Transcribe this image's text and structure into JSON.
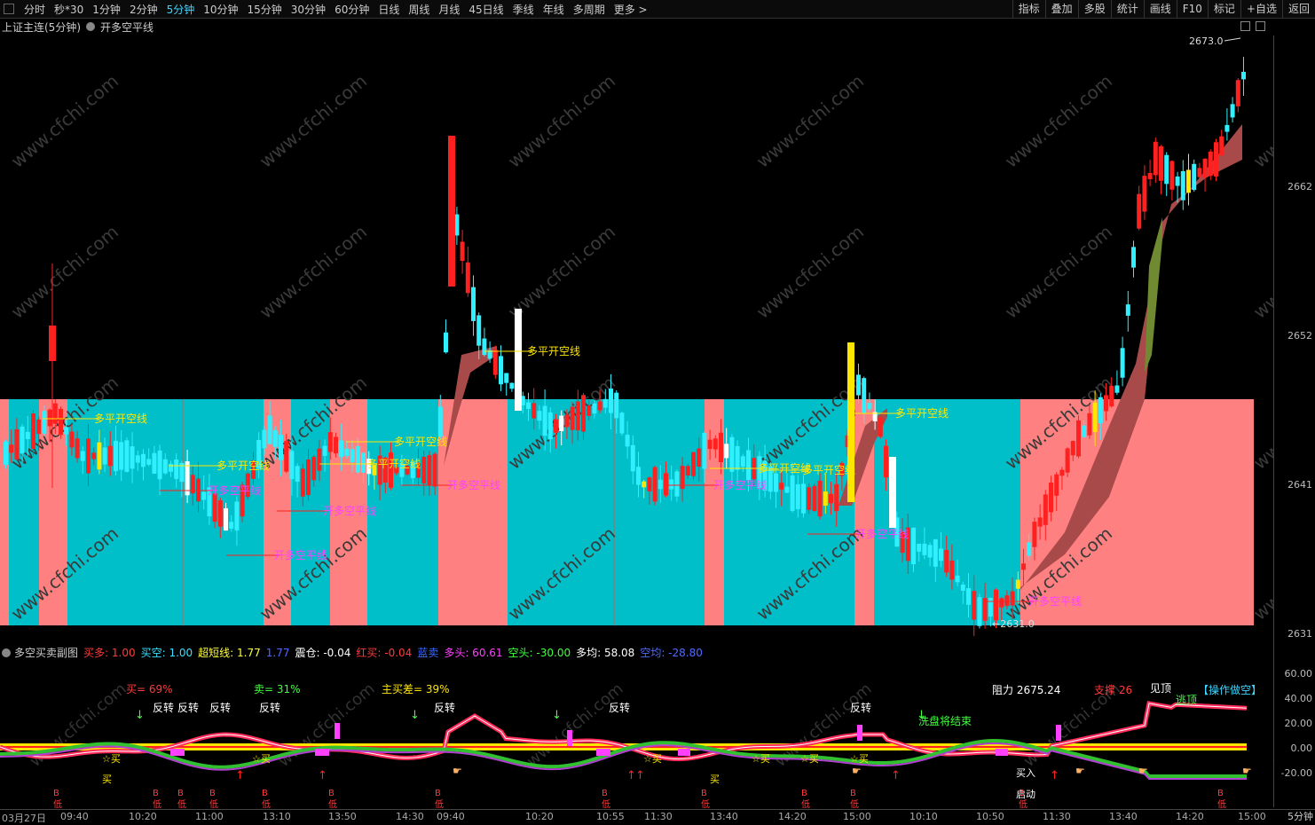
{
  "toolbar": {
    "items": [
      "分时",
      "秒*30",
      "1分钟",
      "2分钟",
      "5分钟",
      "10分钟",
      "15分钟",
      "30分钟",
      "60分钟",
      "日线",
      "周线",
      "月线",
      "45日线",
      "季线",
      "年线",
      "多周期",
      "更多 >"
    ],
    "active": "5分钟",
    "right_items": [
      "指标",
      "叠加",
      "多股",
      "统计",
      "画线",
      "F10",
      "标记",
      "+自选",
      "返回"
    ]
  },
  "chart": {
    "title": "上证主连(5分钟)",
    "indicator": "开多空平线",
    "high_label": "2673.0",
    "low_label": "2631.0",
    "price_axis": [
      "2662",
      "2652",
      "2641",
      "2631"
    ],
    "annotations": {
      "up_line": "多平开空线",
      "down_line": "开多空平线"
    }
  },
  "sub": {
    "name": "多空买卖副图",
    "fields": [
      {
        "label": "买多:",
        "value": "1.00",
        "color": "#ff3b3b"
      },
      {
        "label": "买空:",
        "value": "1.00",
        "color": "#39e0ff"
      },
      {
        "label": "超短线:",
        "value": "1.77",
        "color": "#ffff40"
      },
      {
        "label": "",
        "value": "1.77",
        "color": "#4f6bff"
      },
      {
        "label": "震仓:",
        "value": "-0.04",
        "color": "#ffffff"
      },
      {
        "label": "红买:",
        "value": "-0.04",
        "color": "#ff3b3b"
      },
      {
        "label": "蓝卖",
        "value": "",
        "color": "#3b6bff"
      },
      {
        "label": "多头:",
        "value": "60.61",
        "color": "#ff40ff"
      },
      {
        "label": "空头:",
        "value": "-30.00",
        "color": "#40ff40"
      },
      {
        "label": "多均:",
        "value": "58.08",
        "color": "#ffffff"
      },
      {
        "label": "空均:",
        "value": "-28.80",
        "color": "#4f6bff"
      }
    ],
    "stats": {
      "buy": "买= 69%",
      "sell": "卖= 31%",
      "diff": "主买差= 39%"
    },
    "resistance_label": "阻力",
    "resistance_value": "2675.24",
    "support_label": "支撑",
    "support_value": "26",
    "top_label": "见顶",
    "escape_label": "逃顶",
    "mark_label": "【操作做空】",
    "reverse": "反转",
    "wash": "洗盘将结束",
    "buy_star": "☆买",
    "buy": "买",
    "buy_in": "买入",
    "start": "启动",
    "b_low_b": "B",
    "b_low_l": "低",
    "sub_axis": [
      "60.00",
      "40.00",
      "20.00",
      "0.00",
      "-20.00"
    ]
  },
  "time_axis": [
    "03月27日",
    "09:40",
    "10:20",
    "11:00",
    "13:10",
    "13:50",
    "14:30",
    "09:40",
    "10:20",
    "10:55",
    "11:30",
    "13:40",
    "14:20",
    "15:00",
    "10:10",
    "10:50",
    "11:30",
    "13:40",
    "14:20",
    "15:00"
  ],
  "timeframe": "5分钟",
  "colors": {
    "up": "#ff2020",
    "down": "#30f0ff",
    "cyan_bg": "#00bfc8",
    "pink_bg": "#ff8080"
  }
}
